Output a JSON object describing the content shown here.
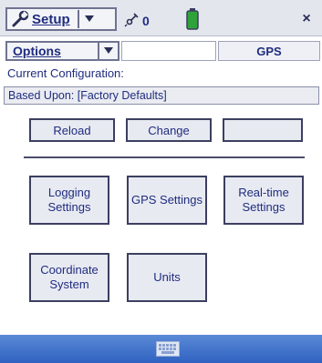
{
  "titlebar": {
    "app_menu_label": "Setup",
    "satellite_count": "0",
    "close_label": "×"
  },
  "options_row": {
    "options_label": "Options",
    "gps_tab_label": "GPS"
  },
  "config": {
    "current_label": "Current Configuration:",
    "based_upon": "Based Upon: [Factory Defaults]"
  },
  "top_buttons": {
    "reload": "Reload",
    "change": "Change",
    "blank": ""
  },
  "settings_buttons": {
    "logging": "Logging Settings",
    "gps": "GPS Settings",
    "realtime": "Real-time Settings",
    "coordinate": "Coordinate System",
    "units": "Units"
  },
  "icons": {
    "wrench": "wrench-icon",
    "satellite": "satellite-icon",
    "battery": "battery-icon",
    "keyboard": "keyboard-icon"
  },
  "colors": {
    "text": "#1f2c7e",
    "battery": "#2fa23a",
    "bottom_bar": "#3d70cb"
  }
}
